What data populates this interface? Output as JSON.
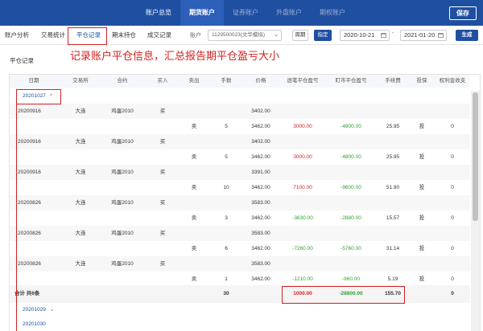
{
  "topnav": {
    "items": [
      "账户总览",
      "期货账户",
      "证券账户",
      "外盘账户",
      "期权账户"
    ],
    "save": "保存"
  },
  "subtabs": [
    "账户分析",
    "交易统计",
    "平仓记录",
    "期末持仓",
    "成交记录"
  ],
  "toolbar": {
    "account_label": "账户",
    "account_value": "1129500023(文华模拟)",
    "week": "周期",
    "custom": "指定",
    "date_start": "2020-10-21",
    "date_sep": "-",
    "date_end": "2021-01-20",
    "generate": "生成"
  },
  "panel_title": "平仓记录",
  "annotation": "记录账户平仓信息，汇总报告期平仓盈亏大小",
  "table": {
    "headers": [
      "日期",
      "交易所",
      "合约",
      "买入",
      "卖出",
      "手数",
      "价格",
      "逐笔平仓盈亏",
      "盯市平仓盈亏",
      "手续费",
      "投保",
      "权利金收支"
    ],
    "group_label": "20201027",
    "group_chevron": "^",
    "rows": [
      {
        "date": "20200916",
        "exch": "大连",
        "contract": "鸡蛋2010",
        "buy": "买",
        "sell": "",
        "qty": "",
        "price": "3402.00",
        "pl1": "",
        "pl2": "",
        "fee": "",
        "hedge": "",
        "premium": ""
      },
      {
        "date": "",
        "exch": "",
        "contract": "",
        "buy": "",
        "sell": "卖",
        "qty": "5",
        "price": "3462.00",
        "pl1": "3000.00",
        "pl2": "-4800.00",
        "fee": "25.95",
        "hedge": "投",
        "premium": "0"
      },
      {
        "date": "20200916",
        "exch": "大连",
        "contract": "鸡蛋2010",
        "buy": "买",
        "sell": "",
        "qty": "",
        "price": "3402.00",
        "pl1": "",
        "pl2": "",
        "fee": "",
        "hedge": "",
        "premium": ""
      },
      {
        "date": "",
        "exch": "",
        "contract": "",
        "buy": "",
        "sell": "卖",
        "qty": "5",
        "price": "3462.00",
        "pl1": "3000.00",
        "pl2": "-4800.00",
        "fee": "25.95",
        "hedge": "投",
        "premium": "0"
      },
      {
        "date": "20200916",
        "exch": "大连",
        "contract": "鸡蛋2010",
        "buy": "买",
        "sell": "",
        "qty": "",
        "price": "3391.00",
        "pl1": "",
        "pl2": "",
        "fee": "",
        "hedge": "",
        "premium": ""
      },
      {
        "date": "",
        "exch": "",
        "contract": "",
        "buy": "",
        "sell": "卖",
        "qty": "10",
        "price": "3462.00",
        "pl1": "7100.00",
        "pl2": "-9600.00",
        "fee": "51.90",
        "hedge": "投",
        "premium": "0"
      },
      {
        "date": "20200826",
        "exch": "大连",
        "contract": "鸡蛋2010",
        "buy": "买",
        "sell": "",
        "qty": "",
        "price": "3583.00",
        "pl1": "",
        "pl2": "",
        "fee": "",
        "hedge": "",
        "premium": ""
      },
      {
        "date": "",
        "exch": "",
        "contract": "",
        "buy": "",
        "sell": "卖",
        "qty": "3",
        "price": "3462.00",
        "pl1": "-3630.00",
        "pl2": "-2880.00",
        "fee": "15.57",
        "hedge": "投",
        "premium": "0"
      },
      {
        "date": "20200826",
        "exch": "大连",
        "contract": "鸡蛋2010",
        "buy": "买",
        "sell": "",
        "qty": "",
        "price": "3583.00",
        "pl1": "",
        "pl2": "",
        "fee": "",
        "hedge": "",
        "premium": ""
      },
      {
        "date": "",
        "exch": "",
        "contract": "",
        "buy": "",
        "sell": "卖",
        "qty": "6",
        "price": "3462.00",
        "pl1": "-7260.00",
        "pl2": "-5760.00",
        "fee": "31.14",
        "hedge": "投",
        "premium": "0"
      },
      {
        "date": "20200826",
        "exch": "大连",
        "contract": "鸡蛋2010",
        "buy": "买",
        "sell": "",
        "qty": "",
        "price": "3583.00",
        "pl1": "",
        "pl2": "",
        "fee": "",
        "hedge": "",
        "premium": ""
      },
      {
        "date": "",
        "exch": "",
        "contract": "",
        "buy": "",
        "sell": "卖",
        "qty": "1",
        "price": "3462.00",
        "pl1": "-1210.00",
        "pl2": "-960.00",
        "fee": "5.19",
        "hedge": "投",
        "premium": "0"
      }
    ],
    "total": {
      "label": "合计  共6条",
      "qty": "30",
      "pl1": "1000.00",
      "pl2": "-28800.00",
      "fee": "155.70",
      "premium": "0"
    },
    "more_groups": [
      "20201029",
      "20201030"
    ]
  },
  "colors": {
    "nav_blue": "#1f4fa0",
    "profit_red": "#d42020",
    "loss_green": "#2f9e2f",
    "highlight_red": "#d42020"
  }
}
